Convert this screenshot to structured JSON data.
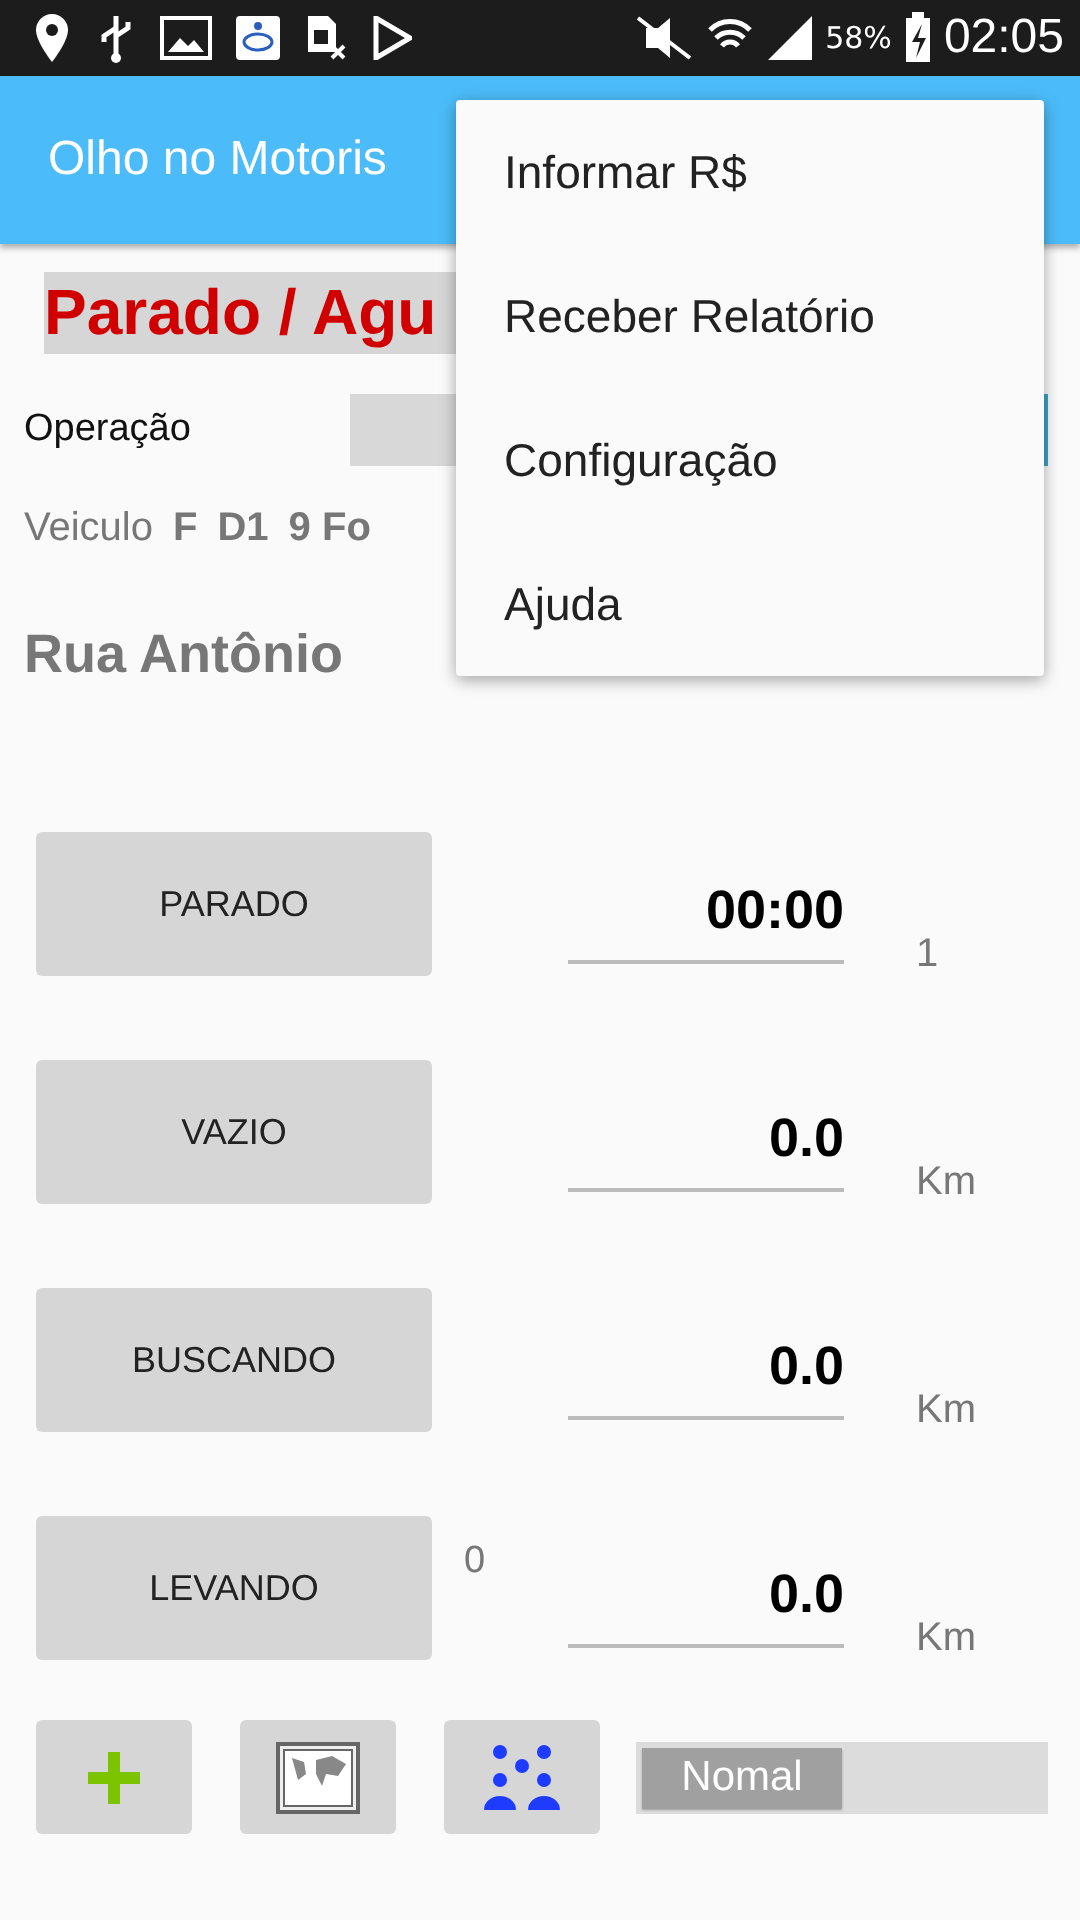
{
  "status_bar": {
    "battery": "58%",
    "time": "02:05"
  },
  "app_bar": {
    "title": "Olho no Motoris"
  },
  "status_title": "Parado / Agu",
  "operation": {
    "label": "Operação"
  },
  "vehicle": {
    "label": "Veiculo",
    "parts": [
      "F",
      "D1",
      "9 Fo"
    ]
  },
  "address": "Rua Antônio",
  "rows": [
    {
      "button": "PARADO",
      "value": "00:00",
      "unit": "1"
    },
    {
      "button": "VAZIO",
      "value": "0.0",
      "unit": "Km"
    },
    {
      "button": "BUSCANDO",
      "value": "0.0",
      "unit": "Km"
    },
    {
      "button": "LEVANDO",
      "note": "0",
      "value": "0.0",
      "unit": "Km"
    }
  ],
  "tools": [
    {
      "kind": "add"
    },
    {
      "kind": "map"
    },
    {
      "kind": "people"
    }
  ],
  "mode_toggle": {
    "label": "Nomal",
    "on": false
  },
  "menu": {
    "items": [
      "Informar R$",
      "Receber Relatório",
      "Configuração",
      "Ajuda"
    ]
  }
}
